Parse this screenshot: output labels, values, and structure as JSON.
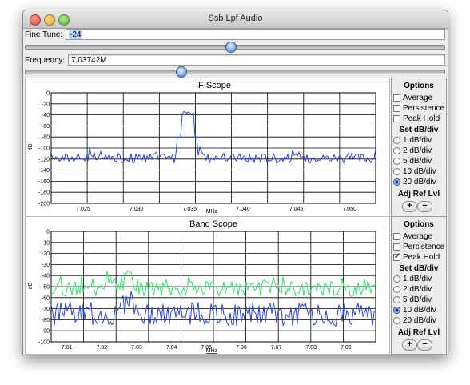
{
  "window": {
    "title": "Ssb Lpf Audio"
  },
  "fine_tune": {
    "label": "Fine Tune:",
    "value": "-24"
  },
  "frequency": {
    "label": "Frequency:",
    "value": "7.03742M"
  },
  "if_scope": {
    "title": "IF Scope",
    "xlabel": "MHz",
    "ylabel": "dB",
    "y_ticks": [
      "0",
      "-20",
      "-40",
      "-60",
      "-80",
      "-100",
      "-120",
      "-140",
      "-160",
      "-180",
      "-200"
    ],
    "x_ticks": [
      "7.025",
      "7.030",
      "7.035",
      "7.040",
      "7.045",
      "7.050"
    ]
  },
  "band_scope": {
    "title": "Band Scope",
    "xlabel": "MHz",
    "ylabel": "dB",
    "y_ticks": [
      "0",
      "-10",
      "-20",
      "-30",
      "-40",
      "-50",
      "-60",
      "-70",
      "-80",
      "-90",
      "-100"
    ],
    "x_ticks": [
      "7.01",
      "7.02",
      "7.03",
      "7.04",
      "7.05",
      "7.06",
      "7.07",
      "7.08",
      "7.09"
    ]
  },
  "options1": {
    "title": "Options",
    "checks": [
      {
        "label": "Average",
        "checked": false
      },
      {
        "label": "Persistence",
        "checked": false
      },
      {
        "label": "Peak Hold",
        "checked": false
      }
    ],
    "db_title": "Set dB/div",
    "radios": [
      {
        "label": "1 dB/div",
        "selected": false
      },
      {
        "label": "2 dB/div",
        "selected": false
      },
      {
        "label": "5 dB/div",
        "selected": false
      },
      {
        "label": "10 dB/div",
        "selected": false
      },
      {
        "label": "20 dB/div",
        "selected": true
      }
    ],
    "adj_title": "Adj Ref Lvl",
    "plus": "+",
    "minus": "−"
  },
  "options2": {
    "title": "Options",
    "checks": [
      {
        "label": "Average",
        "checked": false
      },
      {
        "label": "Persistence",
        "checked": false
      },
      {
        "label": "Peak Hold",
        "checked": true
      }
    ],
    "db_title": "Set dB/div",
    "radios": [
      {
        "label": "1 dB/div",
        "selected": false
      },
      {
        "label": "2 dB/div",
        "selected": false
      },
      {
        "label": "5 dB/div",
        "selected": false
      },
      {
        "label": "10 dB/div",
        "selected": true
      },
      {
        "label": "20 dB/div",
        "selected": false
      }
    ],
    "adj_title": "Adj Ref Lvl",
    "plus": "+",
    "minus": "−"
  },
  "colors": {
    "trace_blue": "#2b43d6",
    "trace_green": "#33e06a",
    "grid": "#000000"
  }
}
